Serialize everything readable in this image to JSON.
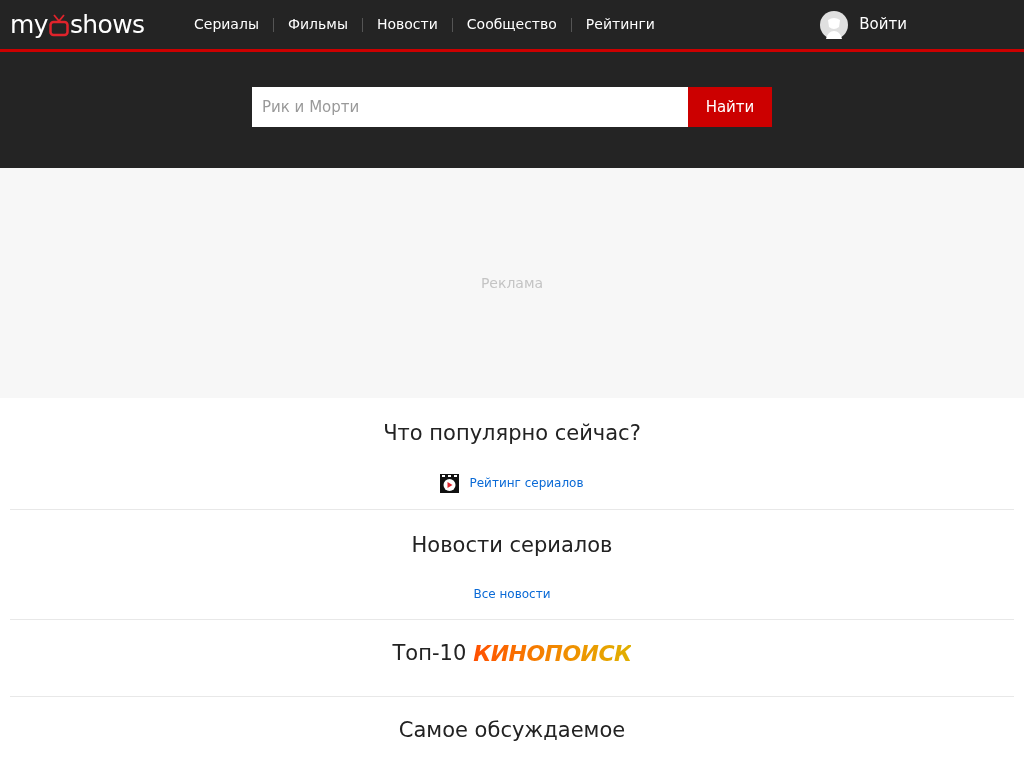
{
  "header": {
    "logo": {
      "left": "my",
      "right": "shows"
    },
    "nav": [
      {
        "label": "Сериалы"
      },
      {
        "label": "Фильмы"
      },
      {
        "label": "Новости"
      },
      {
        "label": "Сообщество"
      },
      {
        "label": "Рейтинги"
      }
    ],
    "login": "Войти"
  },
  "search": {
    "placeholder": "Рик и Морти",
    "button": "Найти"
  },
  "ad": {
    "label": "Реклама"
  },
  "sections": [
    {
      "kind": "links",
      "title": "Что популярно сейчас?",
      "link": "Рейтинг сериалов",
      "icon": true
    },
    {
      "kind": "links",
      "title": "Новости сериалов",
      "link": "Все новости",
      "icon": false
    },
    {
      "kind": "brand",
      "title": "Топ-10",
      "brand": "КИНОПОИСК"
    },
    {
      "kind": "plain",
      "title": "Самое обсуждаемое"
    }
  ]
}
